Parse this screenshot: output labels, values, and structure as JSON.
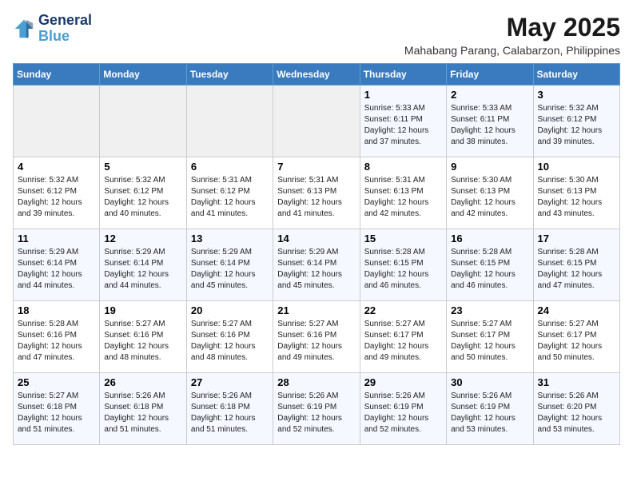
{
  "header": {
    "logo_line1": "General",
    "logo_line2": "Blue",
    "title": "May 2025",
    "subtitle": "Mahabang Parang, Calabarzon, Philippines"
  },
  "days_of_week": [
    "Sunday",
    "Monday",
    "Tuesday",
    "Wednesday",
    "Thursday",
    "Friday",
    "Saturday"
  ],
  "weeks": [
    [
      {
        "day": "",
        "content": ""
      },
      {
        "day": "",
        "content": ""
      },
      {
        "day": "",
        "content": ""
      },
      {
        "day": "",
        "content": ""
      },
      {
        "day": "1",
        "content": "Sunrise: 5:33 AM\nSunset: 6:11 PM\nDaylight: 12 hours and 37 minutes."
      },
      {
        "day": "2",
        "content": "Sunrise: 5:33 AM\nSunset: 6:11 PM\nDaylight: 12 hours and 38 minutes."
      },
      {
        "day": "3",
        "content": "Sunrise: 5:32 AM\nSunset: 6:12 PM\nDaylight: 12 hours and 39 minutes."
      }
    ],
    [
      {
        "day": "4",
        "content": "Sunrise: 5:32 AM\nSunset: 6:12 PM\nDaylight: 12 hours and 39 minutes."
      },
      {
        "day": "5",
        "content": "Sunrise: 5:32 AM\nSunset: 6:12 PM\nDaylight: 12 hours and 40 minutes."
      },
      {
        "day": "6",
        "content": "Sunrise: 5:31 AM\nSunset: 6:12 PM\nDaylight: 12 hours and 41 minutes."
      },
      {
        "day": "7",
        "content": "Sunrise: 5:31 AM\nSunset: 6:13 PM\nDaylight: 12 hours and 41 minutes."
      },
      {
        "day": "8",
        "content": "Sunrise: 5:31 AM\nSunset: 6:13 PM\nDaylight: 12 hours and 42 minutes."
      },
      {
        "day": "9",
        "content": "Sunrise: 5:30 AM\nSunset: 6:13 PM\nDaylight: 12 hours and 42 minutes."
      },
      {
        "day": "10",
        "content": "Sunrise: 5:30 AM\nSunset: 6:13 PM\nDaylight: 12 hours and 43 minutes."
      }
    ],
    [
      {
        "day": "11",
        "content": "Sunrise: 5:29 AM\nSunset: 6:14 PM\nDaylight: 12 hours and 44 minutes."
      },
      {
        "day": "12",
        "content": "Sunrise: 5:29 AM\nSunset: 6:14 PM\nDaylight: 12 hours and 44 minutes."
      },
      {
        "day": "13",
        "content": "Sunrise: 5:29 AM\nSunset: 6:14 PM\nDaylight: 12 hours and 45 minutes."
      },
      {
        "day": "14",
        "content": "Sunrise: 5:29 AM\nSunset: 6:14 PM\nDaylight: 12 hours and 45 minutes."
      },
      {
        "day": "15",
        "content": "Sunrise: 5:28 AM\nSunset: 6:15 PM\nDaylight: 12 hours and 46 minutes."
      },
      {
        "day": "16",
        "content": "Sunrise: 5:28 AM\nSunset: 6:15 PM\nDaylight: 12 hours and 46 minutes."
      },
      {
        "day": "17",
        "content": "Sunrise: 5:28 AM\nSunset: 6:15 PM\nDaylight: 12 hours and 47 minutes."
      }
    ],
    [
      {
        "day": "18",
        "content": "Sunrise: 5:28 AM\nSunset: 6:16 PM\nDaylight: 12 hours and 47 minutes."
      },
      {
        "day": "19",
        "content": "Sunrise: 5:27 AM\nSunset: 6:16 PM\nDaylight: 12 hours and 48 minutes."
      },
      {
        "day": "20",
        "content": "Sunrise: 5:27 AM\nSunset: 6:16 PM\nDaylight: 12 hours and 48 minutes."
      },
      {
        "day": "21",
        "content": "Sunrise: 5:27 AM\nSunset: 6:16 PM\nDaylight: 12 hours and 49 minutes."
      },
      {
        "day": "22",
        "content": "Sunrise: 5:27 AM\nSunset: 6:17 PM\nDaylight: 12 hours and 49 minutes."
      },
      {
        "day": "23",
        "content": "Sunrise: 5:27 AM\nSunset: 6:17 PM\nDaylight: 12 hours and 50 minutes."
      },
      {
        "day": "24",
        "content": "Sunrise: 5:27 AM\nSunset: 6:17 PM\nDaylight: 12 hours and 50 minutes."
      }
    ],
    [
      {
        "day": "25",
        "content": "Sunrise: 5:27 AM\nSunset: 6:18 PM\nDaylight: 12 hours and 51 minutes."
      },
      {
        "day": "26",
        "content": "Sunrise: 5:26 AM\nSunset: 6:18 PM\nDaylight: 12 hours and 51 minutes."
      },
      {
        "day": "27",
        "content": "Sunrise: 5:26 AM\nSunset: 6:18 PM\nDaylight: 12 hours and 51 minutes."
      },
      {
        "day": "28",
        "content": "Sunrise: 5:26 AM\nSunset: 6:19 PM\nDaylight: 12 hours and 52 minutes."
      },
      {
        "day": "29",
        "content": "Sunrise: 5:26 AM\nSunset: 6:19 PM\nDaylight: 12 hours and 52 minutes."
      },
      {
        "day": "30",
        "content": "Sunrise: 5:26 AM\nSunset: 6:19 PM\nDaylight: 12 hours and 53 minutes."
      },
      {
        "day": "31",
        "content": "Sunrise: 5:26 AM\nSunset: 6:20 PM\nDaylight: 12 hours and 53 minutes."
      }
    ]
  ]
}
